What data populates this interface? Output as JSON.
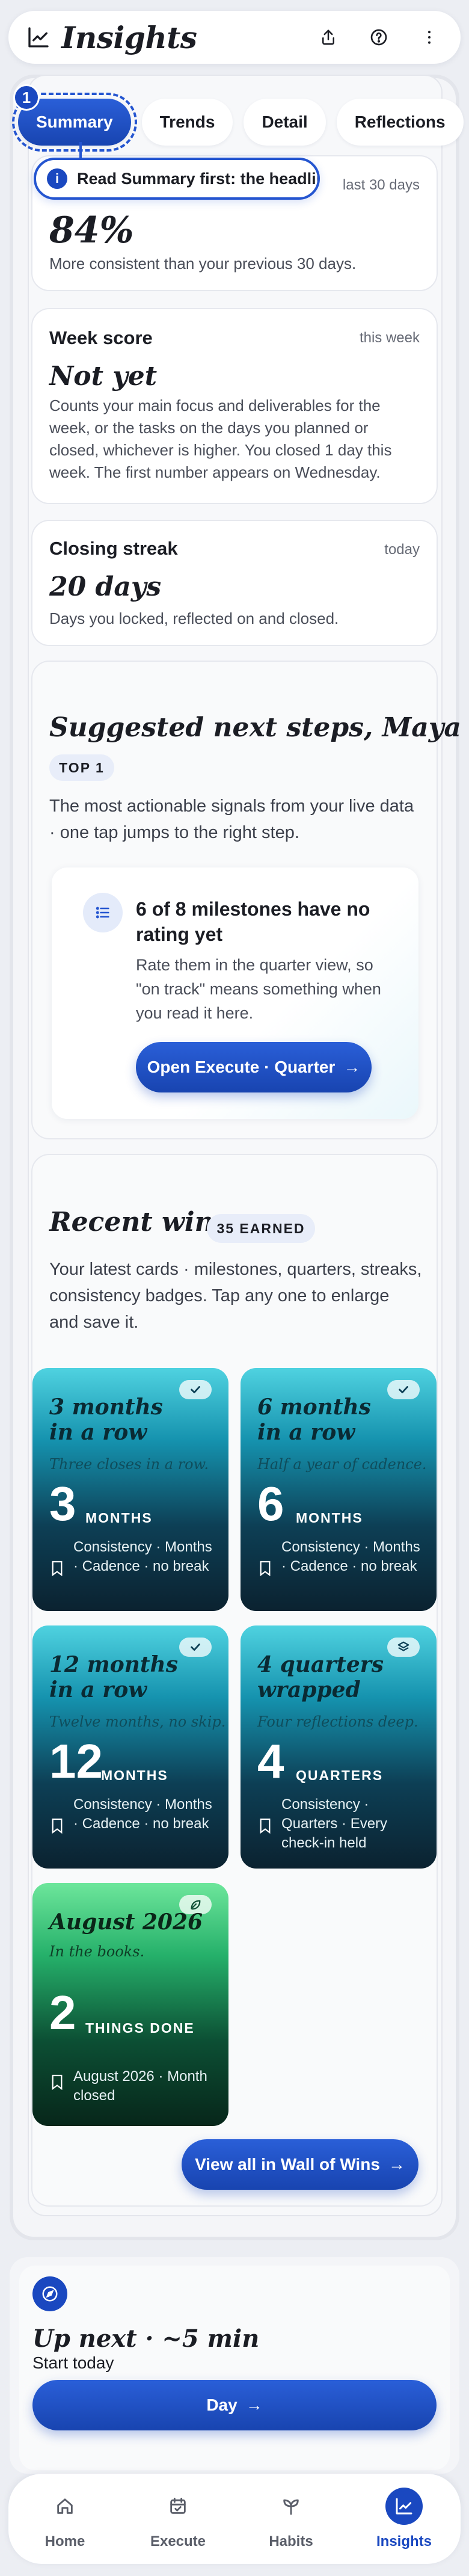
{
  "header": {
    "title": "Insights"
  },
  "tabs": [
    {
      "label": "Summary",
      "active": true
    },
    {
      "label": "Trends"
    },
    {
      "label": "Detail"
    },
    {
      "label": "Reflections"
    }
  ],
  "tour": {
    "step": "1",
    "tooltip": "Read Summary first: the headline"
  },
  "consistency": {
    "meta": "last 30 days",
    "value": "84%",
    "desc": "More consistent than your previous 30 days."
  },
  "week_score": {
    "label": "Week score",
    "meta": "this week",
    "value": "Not yet",
    "desc": "Counts your main focus and deliverables for the week, or the tasks on the days you planned or closed, whichever is higher. You closed 1 day this week. The first number appears on Wednesday."
  },
  "closing_streak": {
    "label": "Closing streak",
    "meta": "today",
    "value": "20 days",
    "desc": "Days you locked, reflected on and closed."
  },
  "suggested": {
    "title": "Suggested next steps, Maya",
    "pill": "TOP 1",
    "desc": "The most actionable signals from your live data · one tap jumps to the right step.",
    "card": {
      "title": "6 of 8 milestones have no rating yet",
      "desc": "Rate them in the quarter view, so \"on track\" means something when you read it here.",
      "cta": "Open Execute · Quarter",
      "arrow": "→"
    }
  },
  "wins": {
    "title": "Recent wins",
    "pill": "35 EARNED",
    "desc": "Your latest cards · milestones, quarters, streaks, consistency badges. Tap any one to enlarge and save it.",
    "cards": [
      {
        "title": "3 months in a row",
        "subtitle": "Three closes in a row.",
        "number": "3",
        "unit": "MONTHS",
        "meta": "Consistency · Months · Cadence · no break",
        "chip": "check"
      },
      {
        "title": "6 months in a row",
        "subtitle": "Half a year of cadence.",
        "number": "6",
        "unit": "MONTHS",
        "meta": "Consistency · Months · Cadence · no break",
        "chip": "check"
      },
      {
        "title": "12 months in a row",
        "subtitle": "Twelve months, no skip.",
        "number": "12",
        "unit": "MONTHS",
        "meta": "Consistency · Months · Cadence · no break",
        "chip": "check"
      },
      {
        "title": "4 quarters wrapped",
        "subtitle": "Four reflections deep.",
        "number": "4",
        "unit": "QUARTERS",
        "meta": "Consistency · Quarters · Every check-in held",
        "chip": "layers"
      },
      {
        "title": "August 2026",
        "subtitle": "In the books.",
        "number": "2",
        "unit": "THINGS DONE",
        "meta": "August 2026 · Month closed",
        "chip": "leaf"
      }
    ],
    "cta": "View all in Wall of Wins",
    "arrow": "→"
  },
  "up_next": {
    "title": "Up next · ~5 min",
    "subtitle": "Start today",
    "cta": "Day",
    "arrow": "→"
  },
  "nav": [
    {
      "label": "Home"
    },
    {
      "label": "Execute"
    },
    {
      "label": "Habits"
    },
    {
      "label": "Insights",
      "active": true
    }
  ],
  "colors": {
    "accent": "#1a48c0",
    "cyan_card": "#1592ae",
    "green_card": "#25b06a"
  }
}
